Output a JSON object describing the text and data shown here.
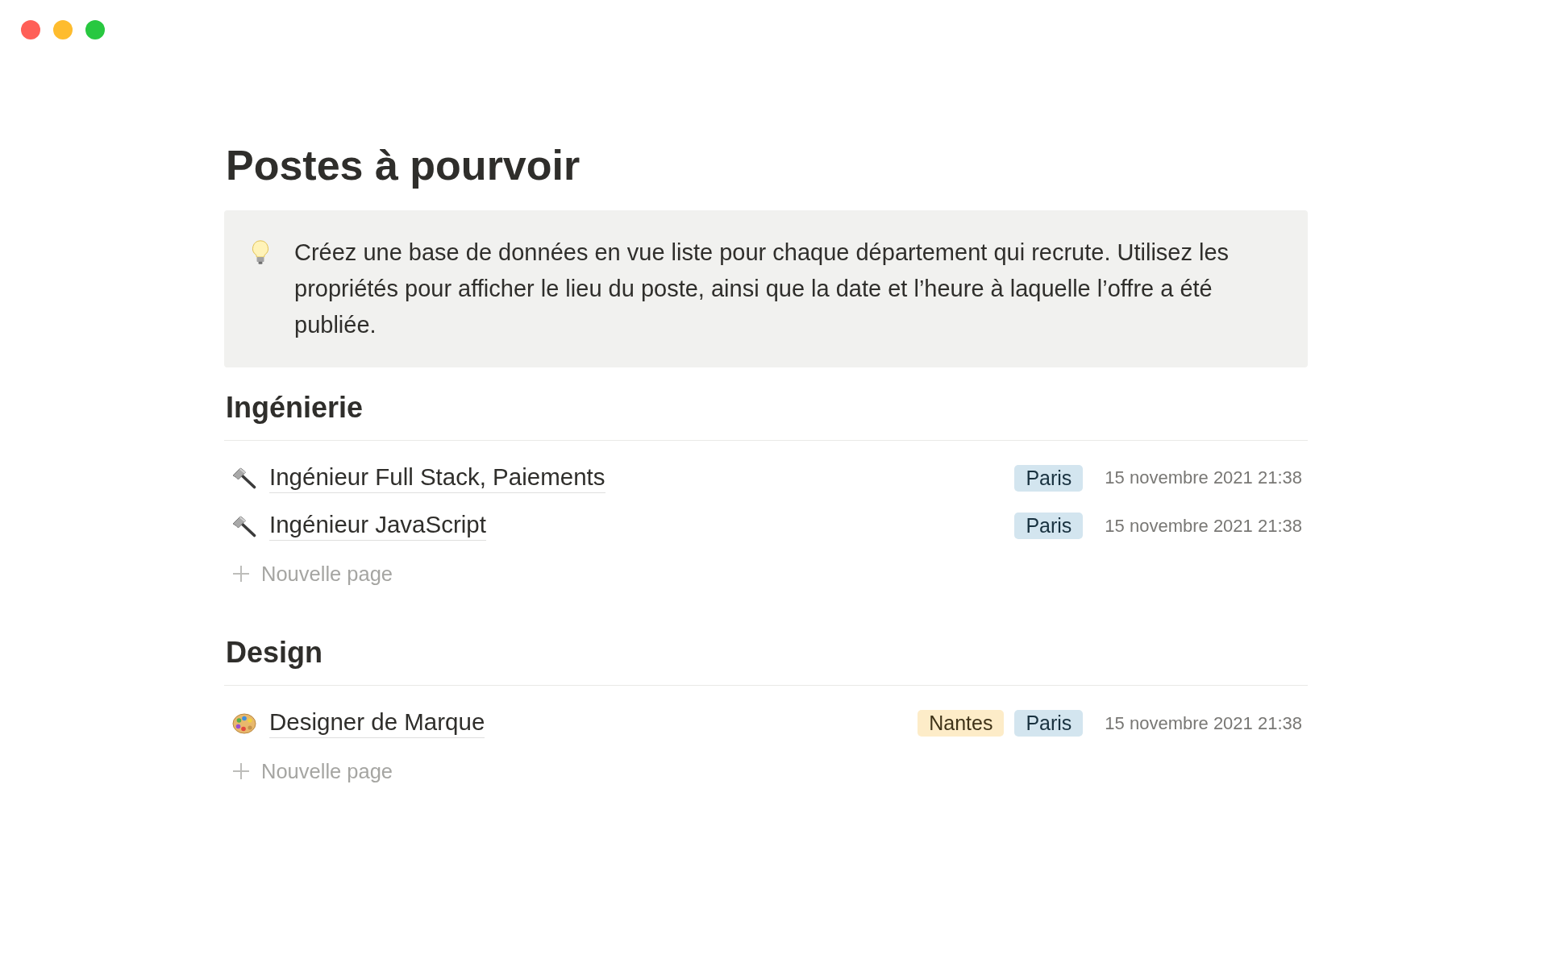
{
  "page": {
    "title": "Postes à pourvoir"
  },
  "callout": {
    "text": "Créez une base de données en vue liste pour chaque département qui recrute. Utilisez les propriétés pour afficher le lieu du poste, ainsi que la date et l’heure à laquelle l’offre a été publiée."
  },
  "sections": [
    {
      "heading": "Ingénierie",
      "rows": [
        {
          "kind": "hammer",
          "title": "Ingénieur Full Stack, Paiements",
          "tags": [
            {
              "label": "Paris",
              "color": "#d3e5ef"
            }
          ],
          "date": "15 novembre 2021 21:38"
        },
        {
          "kind": "hammer",
          "title": "Ingénieur JavaScript",
          "tags": [
            {
              "label": "Paris",
              "color": "#d3e5ef"
            }
          ],
          "date": "15 novembre 2021 21:38"
        }
      ],
      "new_page": "Nouvelle page"
    },
    {
      "heading": "Design",
      "rows": [
        {
          "kind": "palette",
          "title": "Designer de Marque",
          "tags": [
            {
              "label": "Nantes",
              "color": "#fdecc8"
            },
            {
              "label": "Paris",
              "color": "#d3e5ef"
            }
          ],
          "date": "15 novembre 2021 21:38"
        }
      ],
      "new_page": "Nouvelle page"
    }
  ]
}
